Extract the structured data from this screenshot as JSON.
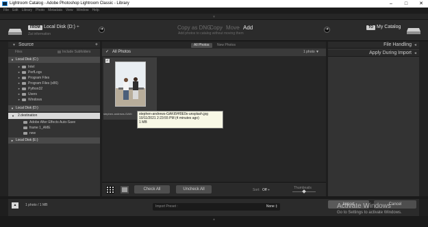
{
  "window": {
    "title": "Lightroom Catalog - Adobe Photoshop Lightroom Classic - Library",
    "controls": [
      "–",
      "□",
      "✕"
    ]
  },
  "menu": [
    "File",
    "Edit",
    "Library",
    "Photo",
    "Metadata",
    "View",
    "Window",
    "Help"
  ],
  "header": {
    "from_badge": "FROM",
    "source_name": "Local Disk (D:) ÷",
    "source_sub": "Zai information",
    "modes": [
      "Copy as DNG",
      "Copy",
      "Move",
      "Add"
    ],
    "active_mode": "Add",
    "mode_separators": [
      "·",
      "·",
      "·"
    ],
    "mode_description": "Add photos to catalog without moving them",
    "to_badge": "TO",
    "destination": "My Catalog"
  },
  "source_panel": {
    "title": "Source",
    "add_symbol": "+",
    "files_label": "Files",
    "include_subfolders": "Include Subfolders",
    "volume_c": "Local Disk (C:)",
    "folders_c": [
      "Intel",
      "PerfLogs",
      "Program Files",
      "Program Files (x86)",
      "Python32",
      "Users",
      "Windows"
    ],
    "volume_d": "Local Disk (D:)",
    "destination_folder": "2.destination",
    "subfolders": [
      "Adobe After Effects Auto-Save",
      "frame 1_AME",
      "new"
    ],
    "volume_e": "Local Disk (E:)"
  },
  "center": {
    "filters": [
      "All Photos",
      "New Photos"
    ],
    "grid_title": "All Photos",
    "photo_count": "1 photo ▼",
    "thumb_label": "stephen-andrews-GAKt",
    "tooltip": {
      "filename": "stephen-andrews-GAKt5Hf0E0s-unsplash.jpg",
      "date": "10/11/2021 2:23:55 PM (4 minutes ago)",
      "size": "1 MB"
    },
    "check_all": "Check All",
    "uncheck_all": "Uncheck All",
    "sort_label": "Sort:",
    "sort_value": "Off ÷",
    "thumbnails_label": "Thumbnails"
  },
  "right_panel": {
    "file_handling": "File Handling",
    "apply_during_import": "Apply During Import"
  },
  "footer": {
    "summary": "1 photo / 1 MB",
    "preset_label": "Import Preset :",
    "preset_value": "None ‡",
    "import_button": "Import",
    "cancel_button": "Cancel"
  },
  "watermark": {
    "title": "Activate Windows",
    "subtitle": "Go to Settings to activate Windows."
  },
  "colors": {
    "panel": "#333333",
    "background": "#1e1e1e",
    "accent_text": "#e6e6e6"
  }
}
